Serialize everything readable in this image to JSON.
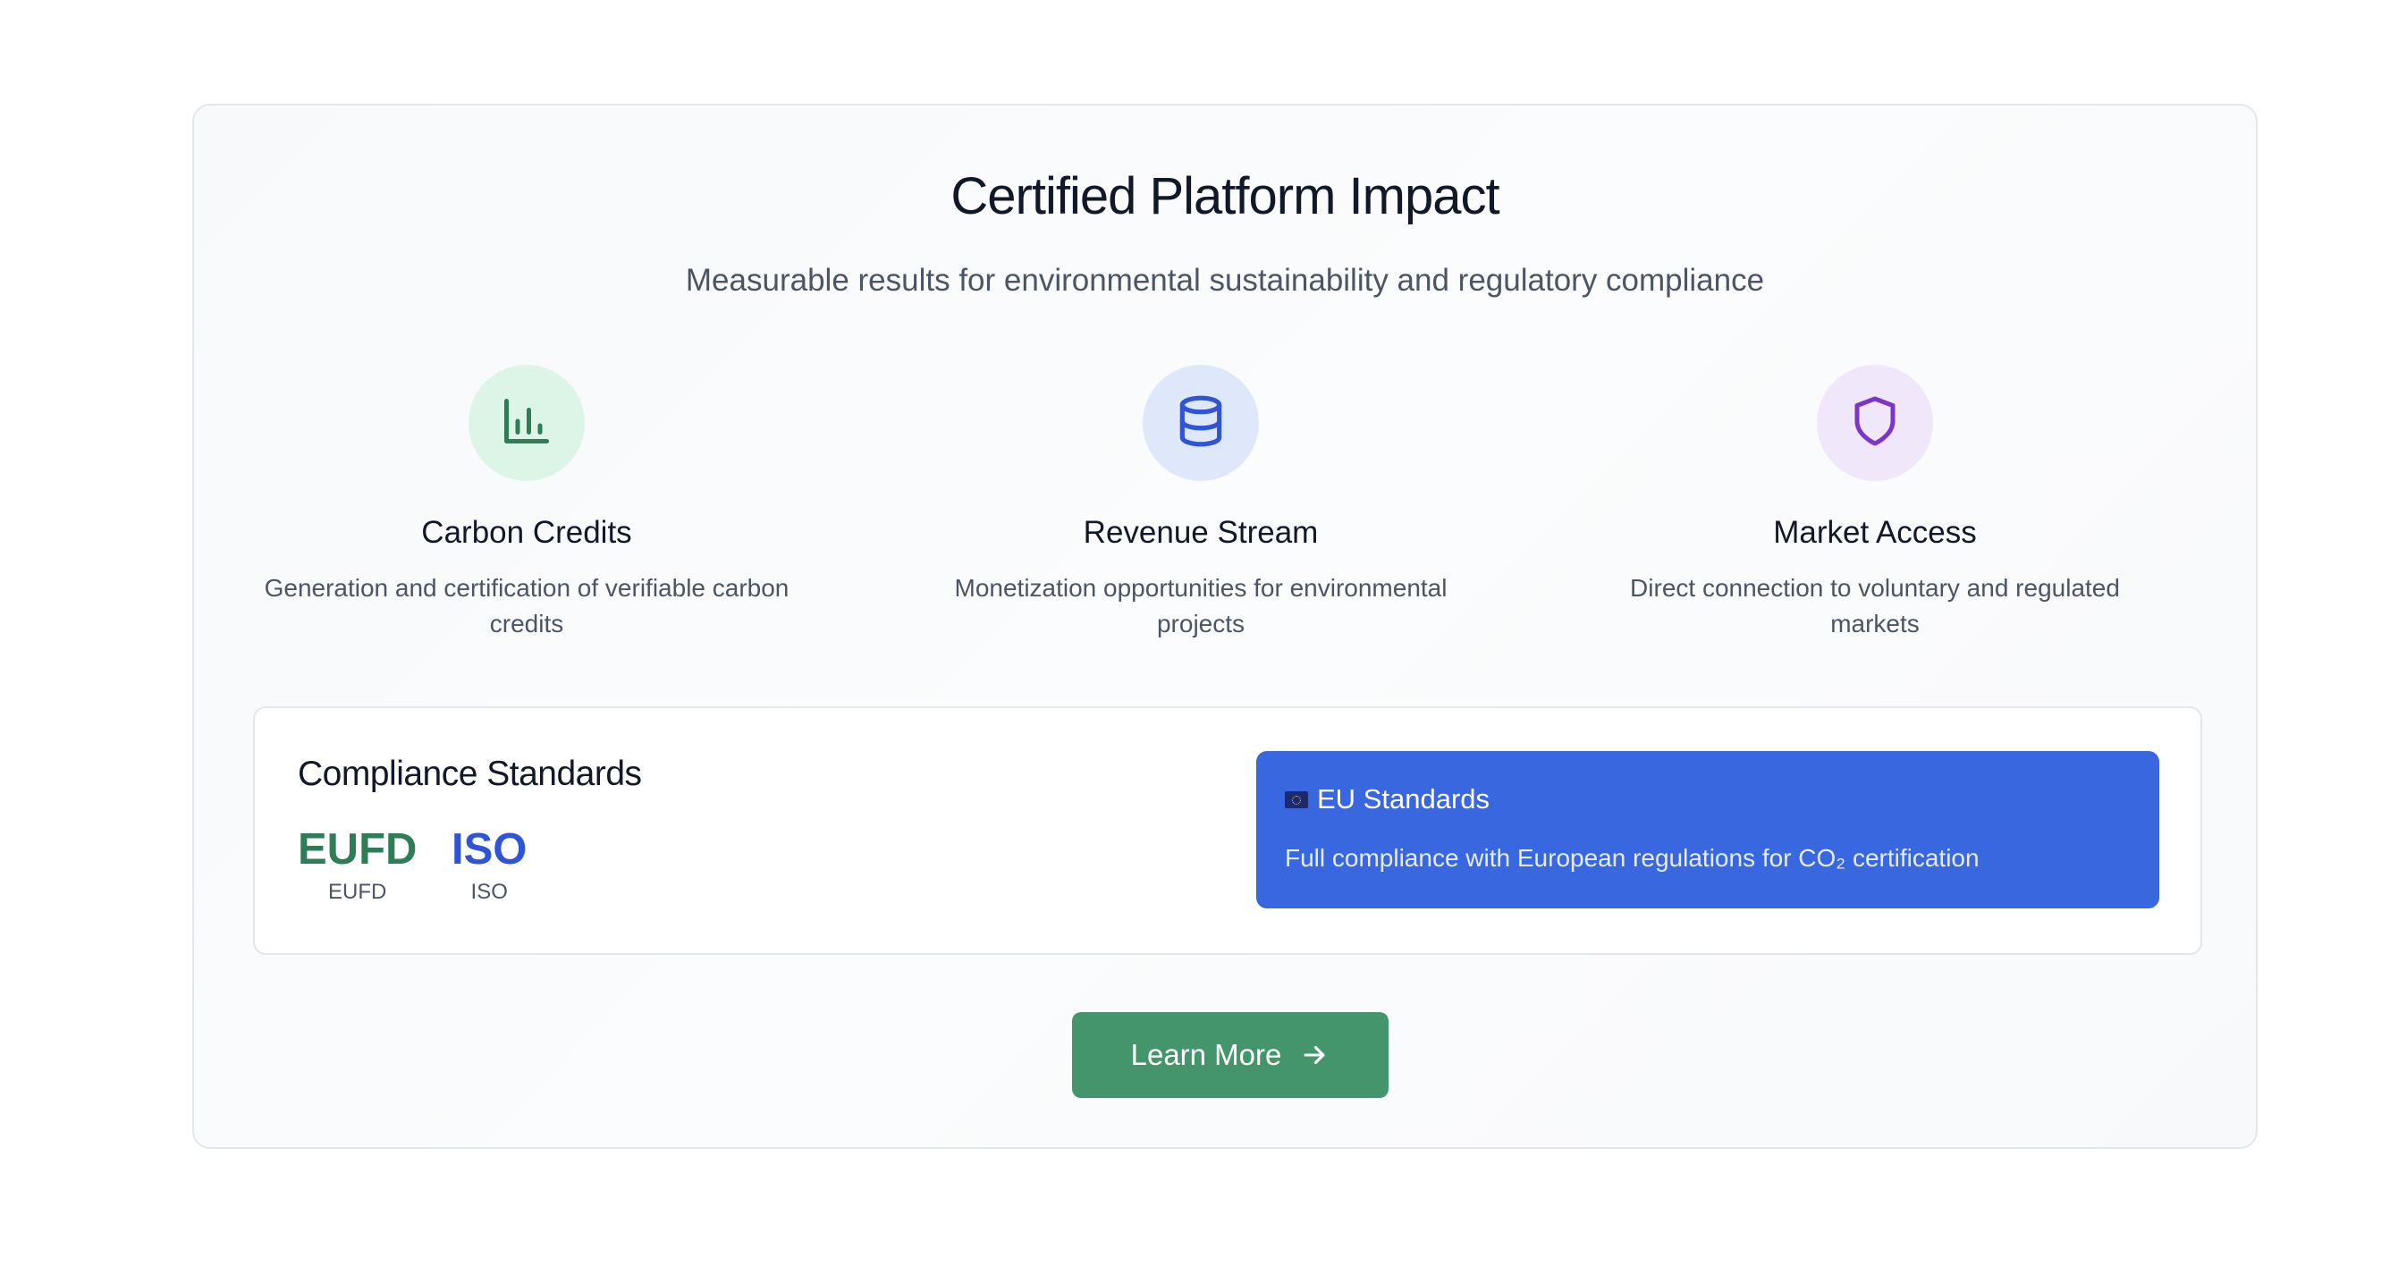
{
  "header": {
    "title": "Certified Platform Impact",
    "subtitle": "Measurable results for environmental sustainability and regulatory compliance"
  },
  "features": [
    {
      "title": "Carbon Credits",
      "description": "Generation and certification of verifiable carbon credits",
      "icon": "bar-chart-icon",
      "icon_color": "#2e7d57",
      "icon_bg": "#dcf5e6"
    },
    {
      "title": "Revenue Stream",
      "description": "Monetization opportunities for environmental projects",
      "icon": "database-icon",
      "icon_color": "#2f54d6",
      "icon_bg": "#dfe8fb"
    },
    {
      "title": "Market Access",
      "description": "Direct connection to voluntary and regulated markets",
      "icon": "shield-icon",
      "icon_color": "#7b35c9",
      "icon_bg": "#f1e7fb"
    }
  ],
  "compliance": {
    "title": "Compliance Standards",
    "standards": [
      {
        "code": "EUFD",
        "label": "EUFD",
        "color": "#2e7d57"
      },
      {
        "code": "ISO",
        "label": "ISO",
        "color": "#2f54d6"
      }
    ],
    "eu_box": {
      "icon": "eu-flag-icon",
      "title": "EU Standards",
      "description": "Full compliance with European regulations for CO₂ certification",
      "background": "#3867e0"
    }
  },
  "cta": {
    "label": "Learn More",
    "icon": "arrow-right-icon",
    "background": "#44956b"
  }
}
